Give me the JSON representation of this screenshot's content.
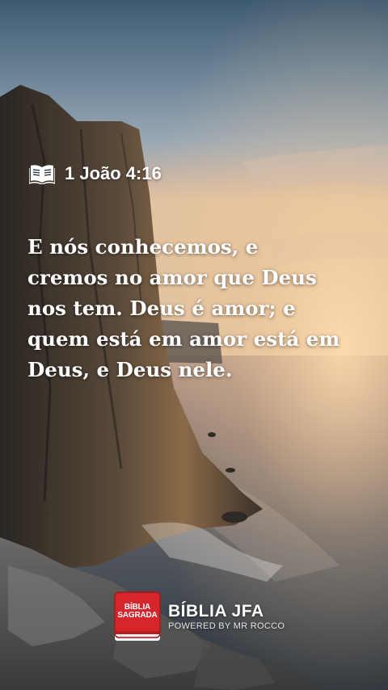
{
  "verse": {
    "reference": "1 João 4:16",
    "lines": [
      "E nós conhecemos, e",
      "cremos no amor que Deus",
      "nos tem. Deus é amor; e",
      "quem está em amor está em",
      "Deus, e Deus nele."
    ]
  },
  "brand": {
    "logo_line1": "BÍBLIA",
    "logo_line2": "SAGRADA",
    "name": "BÍBLIA JFA",
    "tagline": "POWERED BY MR ROCCO",
    "accent_color": "#d6262b"
  },
  "icons": {
    "reference_icon": "open-book-icon"
  }
}
